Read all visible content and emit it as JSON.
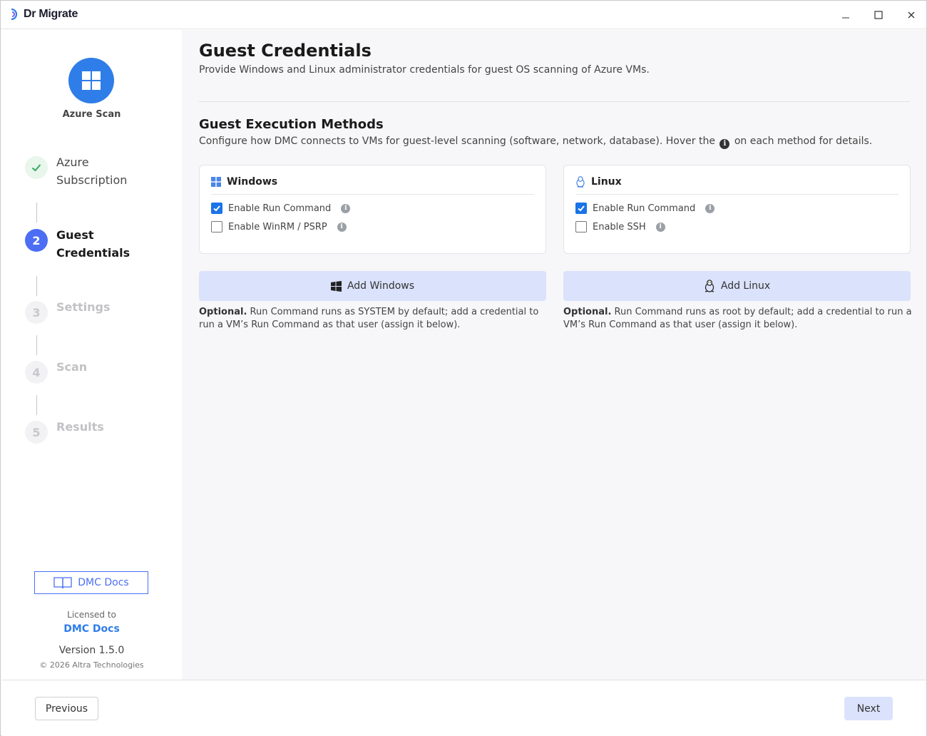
{
  "window": {
    "app_name": "Dr Migrate",
    "controls": {
      "minimize": "minimize-icon",
      "maximize": "maximize-icon",
      "close": "close-icon"
    }
  },
  "sidebar": {
    "scan_title": "Azure Scan",
    "steps": [
      {
        "number": "1",
        "label": "Azure Subscription",
        "state": "done"
      },
      {
        "number": "2",
        "label": "Guest Credentials",
        "state": "active"
      },
      {
        "number": "3",
        "label": "Settings",
        "state": "pending"
      },
      {
        "number": "4",
        "label": "Scan",
        "state": "pending"
      },
      {
        "number": "5",
        "label": "Results",
        "state": "pending"
      }
    ],
    "docs_button": "DMC Docs",
    "licensed_label": "Licensed to",
    "licensed_name": "DMC Docs",
    "version": "Version 1.5.0",
    "copyright": "© 2026 Altra Technologies"
  },
  "main": {
    "title": "Guest Credentials",
    "subtitle": "Provide Windows and Linux administrator credentials for guest OS scanning of Azure VMs.",
    "section_title": "Guest Execution Methods",
    "section_sub_before": "Configure how DMC connects to VMs for guest-level scanning (software, network, database). Hover the",
    "section_sub_after": "on each method for details.",
    "windows": {
      "title": "Windows",
      "options": [
        {
          "label": "Enable Run Command",
          "checked": true
        },
        {
          "label": "Enable WinRM / PSRP",
          "checked": false
        }
      ],
      "add_button": "Add Windows",
      "note_bold": "Optional.",
      "note_text": "Run Command runs as SYSTEM by default; add a credential to run a VM’s Run Command as that user (assign it below)."
    },
    "linux": {
      "title": "Linux",
      "options": [
        {
          "label": "Enable Run Command",
          "checked": true
        },
        {
          "label": "Enable SSH",
          "checked": false
        }
      ],
      "add_button": "Add Linux",
      "note_bold": "Optional.",
      "note_text": "Run Command runs as root by default; add a credential to run a VM’s Run Command as that user (assign it below)."
    }
  },
  "footer": {
    "previous": "Previous",
    "next": "Next"
  },
  "colors": {
    "accent": "#4c6ef5",
    "brand_blue": "#2f7de8",
    "checkbox": "#1a73e8",
    "button_fill": "#dbe2fb",
    "success": "#2eab5a"
  }
}
